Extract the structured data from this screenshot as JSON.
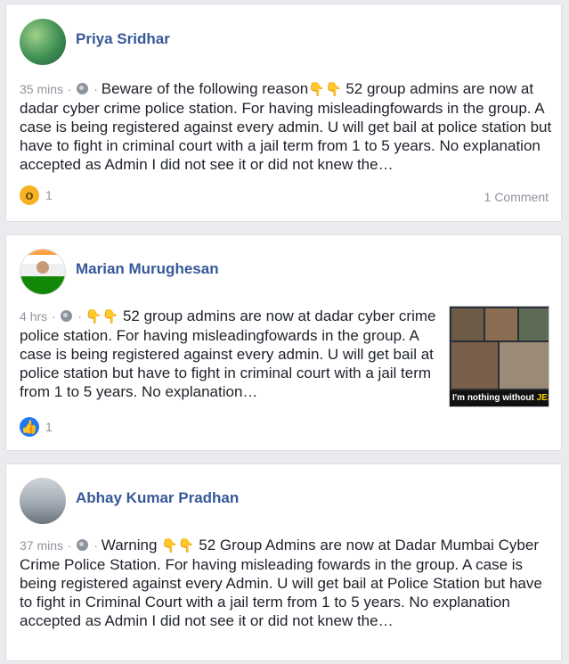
{
  "posts": [
    {
      "author": "Priya Sridhar",
      "time": "35 mins",
      "text": "Beware of the following reason 52 group admins are now at dadar cyber crime police station. For having misleadingfowards in the group. A case is being registered against every admin. U will get bail at police station but have to fight in criminal court with a jail term from 1 to 5 years. No explanation accepted as Admin I did not see it or did not knew the…",
      "text_before_hands": "Beware of the following reason",
      "text_after_hands": " 52 group admins are now at dadar cyber crime police station. For having misleadingfowards in the group. A case is being registered against every admin. U will get bail at police station but have to fight in criminal court with a jail term from 1 to 5 years. No explanation accepted as Admin I did not see it or did not knew the…",
      "reaction_icon": "wow-reaction-icon",
      "reaction_count": "1",
      "comments": "1 Comment"
    },
    {
      "author": "Marian Murughesan",
      "time": "4 hrs",
      "text_before_hands": "",
      "text_after_hands": " 52 group admins are now at dadar cyber crime police station. For having misleadingfowards in the group. A case is being registered against every admin. U will get bail at police station but have to fight in criminal court with a jail term from 1 to 5 years. No explanation…",
      "reaction_icon": "like-reaction-icon",
      "reaction_count": "1",
      "image_caption_prefix": "I'm nothing without ",
      "image_caption_emph": "JESUS"
    },
    {
      "author": "Abhay Kumar Pradhan",
      "time": "37 mins",
      "text_before_hands": "Warning",
      "text_after_hands": " 52 Group Admins are now at Dadar Mumbai Cyber Crime Police Station. For having misleading fowards in the group. A case is being registered against every Admin. U will get bail at Police Station but have to fight in Criminal Court with a jail term from 1 to 5 years. No explanation accepted as Admin I did not see it or did not knew the…"
    }
  ],
  "icons": {
    "privacy": "globe-icon",
    "hand": "pointing-down-hand-icon"
  },
  "colors": {
    "author": "#365899",
    "meta": "#90949c",
    "background": "#e9ebee",
    "like": "#2078f4",
    "wow": "#f7b125"
  }
}
